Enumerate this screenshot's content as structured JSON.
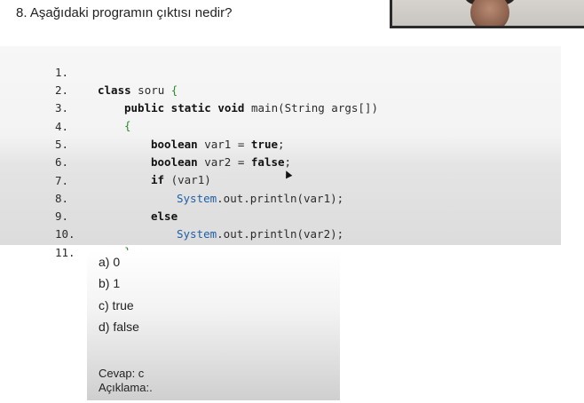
{
  "question": "8. Aşağıdaki programın çıktısı nedir?",
  "code_lines": [
    {
      "no": "1.",
      "text": ""
    },
    {
      "no": "2.",
      "text": ""
    },
    {
      "no": "3.",
      "text": ""
    },
    {
      "no": "4.",
      "text": ""
    },
    {
      "no": "5.",
      "text": ""
    },
    {
      "no": "6.",
      "text": ""
    },
    {
      "no": "7.",
      "text": ""
    },
    {
      "no": "8.",
      "text": ""
    },
    {
      "no": "9.",
      "text": ""
    },
    {
      "no": "10.",
      "text": ""
    },
    {
      "no": "11.",
      "text": ""
    }
  ],
  "code": {
    "l1_kw": "class",
    "l1_rest": " soru ",
    "l1_brace": "{",
    "l2_kw": "public static void",
    "l2_rest": " main(String args[])",
    "l3_brace": "{",
    "l4_kw": "boolean",
    "l4_rest": " var1 = ",
    "l4_val": "true",
    "l4_end": ";",
    "l5_kw": "boolean",
    "l5_rest": " var2 = ",
    "l5_val": "false",
    "l5_end": ";",
    "l6_kw": "if",
    "l6_rest": " (var1)",
    "l7_sys": "System",
    "l7_rest": ".out.println(var1);",
    "l8_kw": "else",
    "l9_sys": "System",
    "l9_rest": ".out.println(var2);",
    "l10_brace": "}",
    "l11_brace": "}"
  },
  "options": [
    "a) 0",
    "b) 1",
    "c) true",
    "d) false"
  ],
  "answer": "Cevap: c",
  "explanation": "Açıklama:."
}
